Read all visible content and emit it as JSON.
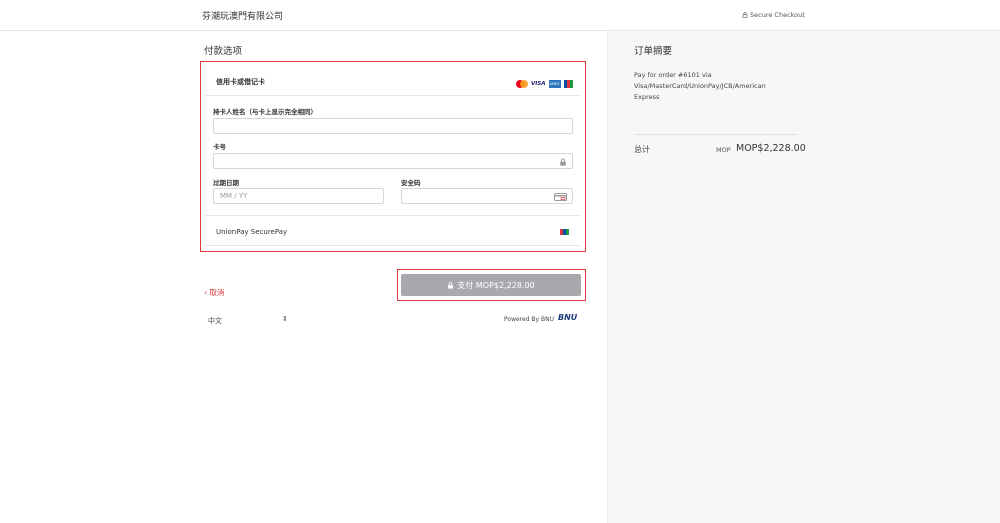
{
  "header": {
    "shop_name": "芬潮玩澳門有限公司",
    "secure_label": "Secure Checkout"
  },
  "payment": {
    "section_title": "付款选项",
    "card_option_label": "信用卡或借记卡",
    "card_brands": [
      "mastercard-icon",
      "visa-icon",
      "amex-icon",
      "jcb-icon"
    ],
    "cardholder_label": "持卡人姓名（与卡上显示完全相同）",
    "cardholder_value": "",
    "card_number_label": "卡号",
    "card_number_value": "",
    "expiry_label": "过期日期",
    "expiry_placeholder": "MM  /  YY",
    "cvc_label": "安全码",
    "cvc_value": "",
    "unionpay_label": "UnionPay SecurePay"
  },
  "actions": {
    "cancel_label": "取消",
    "pay_label": "支付 MOP$2,228.00"
  },
  "footer": {
    "language": "中文",
    "powered_by": "Powered By BNU",
    "bnu_logo": "BNU"
  },
  "summary": {
    "title": "订单摘要",
    "order_description": "Pay for order #6101 via Visa/MasterCard/UnionPay/JCB/American Express",
    "total_label": "总计",
    "currency": "MOP",
    "total_amount": "MOP$2,228.00"
  },
  "colors": {
    "accent_red": "#d9363e",
    "pay_button_bg": "#a7a9ac",
    "panel_bg": "#f7f7f8"
  }
}
